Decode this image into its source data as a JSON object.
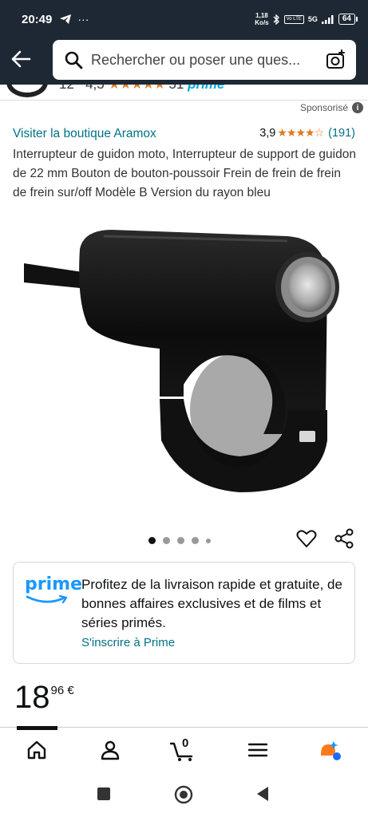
{
  "status_bar": {
    "time": "20:49",
    "net_speed_value": "1,18",
    "net_speed_unit": "Ko/s",
    "volte_label": "Vo LTE",
    "network": "5G",
    "battery": "64"
  },
  "search": {
    "placeholder": "Rechercher ou poser une ques..."
  },
  "previous_item": {
    "price_fragment": "12",
    "rating": "4,5",
    "stars": "★★★★★",
    "reviews": "51",
    "prime": "prime"
  },
  "sponsored_label": "Sponsorisé",
  "product": {
    "store_link": "Visiter la boutique Aramox",
    "rating_value": "3,9",
    "stars": "★★★★☆",
    "review_count": "(191)",
    "title": "Interrupteur de guidon moto, Interrupteur de support de guidon de 22 mm Bouton de bouton-poussoir Frein de frein de frein de frein sur/off Modèle B Version du rayon bleu",
    "image_count": 5,
    "active_image": 1
  },
  "prime_card": {
    "logo_text": "prime",
    "text": "Profitez de la livraison rapide et gratuite, de bonnes affaires exclusives et de films et séries primés.",
    "signup_link": "S'inscrire à Prime"
  },
  "price": {
    "whole": "18",
    "fraction": "96",
    "currency": "€"
  },
  "bottom_nav": {
    "cart_count": "0",
    "active_tab": "home"
  },
  "colors": {
    "header_bg": "#1e2834",
    "link": "#007185",
    "stars": "#de7921",
    "prime_blue": "#1a98ff"
  }
}
